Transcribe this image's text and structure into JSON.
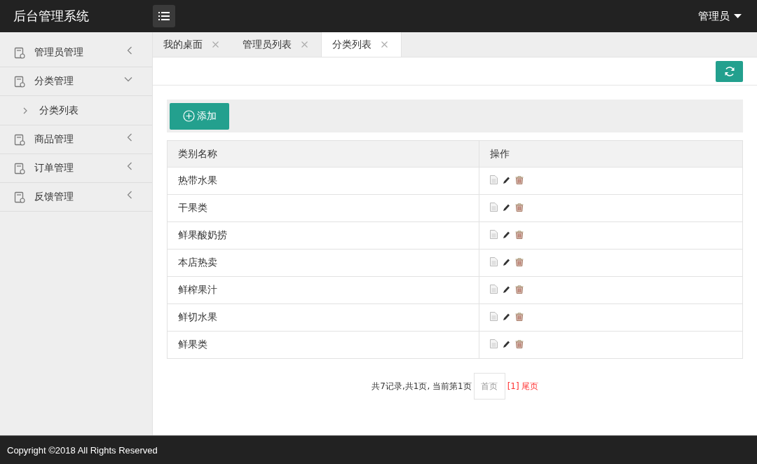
{
  "header": {
    "title": "后台管理系统",
    "user": "管理员"
  },
  "sidebar": {
    "items": [
      {
        "label": "管理员管理",
        "expanded": false
      },
      {
        "label": "分类管理",
        "expanded": true,
        "children": [
          {
            "label": "分类列表"
          }
        ]
      },
      {
        "label": "商品管理",
        "expanded": false
      },
      {
        "label": "订单管理",
        "expanded": false
      },
      {
        "label": "反馈管理",
        "expanded": false
      }
    ]
  },
  "tabs": [
    {
      "label": "我的桌面",
      "selected": false
    },
    {
      "label": "管理员列表",
      "selected": false
    },
    {
      "label": "分类列表",
      "selected": true
    }
  ],
  "toolbar": {
    "add_button": "添加"
  },
  "table": {
    "columns": [
      "类别名称",
      "操作"
    ],
    "rows": [
      {
        "name": "热带水果"
      },
      {
        "name": "干果类"
      },
      {
        "name": "鲜果酸奶捞"
      },
      {
        "name": "本店热卖"
      },
      {
        "name": "鲜榨果汁"
      },
      {
        "name": "鲜切水果"
      },
      {
        "name": "鲜果类"
      }
    ]
  },
  "pagination": {
    "summary": "共7记录,共1页, 当前第1页",
    "first": "首页",
    "current": "[1]",
    "last": "尾页"
  },
  "footer": {
    "text": "Copyright ©2018 All Rights Reserved"
  }
}
